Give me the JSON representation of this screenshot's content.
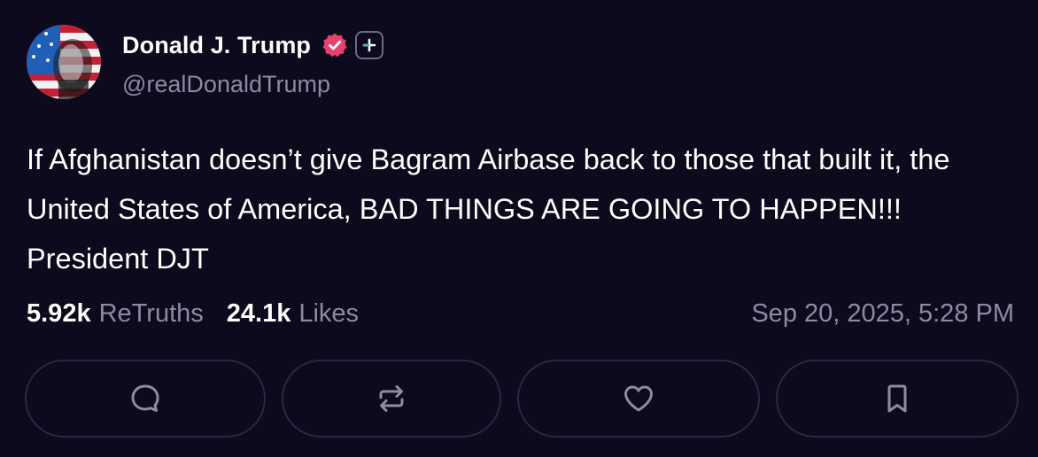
{
  "post": {
    "author": {
      "display_name": "Donald J. Trump",
      "handle": "@realDonaldTrump",
      "verified": true
    },
    "text": "If Afghanistan doesn’t give Bagram Airbase back to those that built it, the United States of America, BAD THINGS ARE GOING TO HAPPEN!!! President DJT",
    "stats": {
      "retruths_count": "5.92k",
      "retruths_label": "ReTruths",
      "likes_count": "24.1k",
      "likes_label": "Likes"
    },
    "timestamp": "Sep 20, 2025, 5:28 PM"
  },
  "actions": [
    {
      "name": "reply",
      "icon": "comment-icon"
    },
    {
      "name": "retruth",
      "icon": "repost-icon"
    },
    {
      "name": "like",
      "icon": "heart-icon"
    },
    {
      "name": "bookmark",
      "icon": "bookmark-icon"
    }
  ],
  "colors": {
    "background": "#0c0a1c",
    "text_primary": "#ffffff",
    "text_secondary": "#8e8aa2",
    "verified_badge": "#e8416e",
    "button_border": "#2a2744"
  }
}
